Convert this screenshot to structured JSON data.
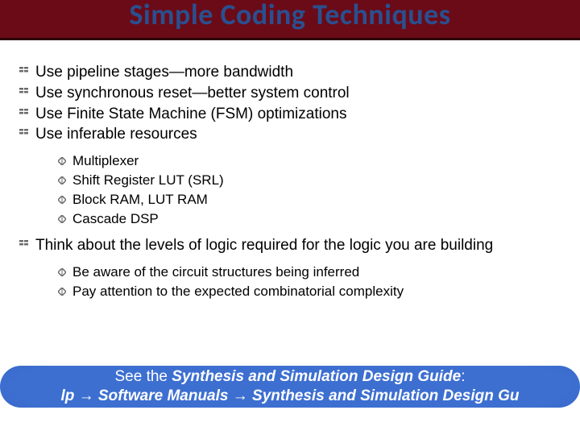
{
  "title": "Simple Coding Techniques",
  "bullets_top": [
    "Use pipeline stages—more bandwidth",
    "Use synchronous reset—better system control",
    "Use Finite State Machine (FSM) optimizations",
    "Use inferable resources"
  ],
  "sub_resources": [
    "Multiplexer",
    "Shift Register LUT (SRL)",
    "Block RAM, LUT RAM",
    "Cascade DSP"
  ],
  "bullets_mid": [
    "Think about the levels of logic required for the logic you are building"
  ],
  "sub_advice": [
    "Be aware of the circuit structures being inferred",
    "Pay attention to the expected combinatorial complexity"
  ],
  "footer": {
    "line1_a": "See the ",
    "line1_b": "Synthesis and Simulation Design Guide",
    "line1_c": ":",
    "line2_a": "lp ",
    "arrow": "→",
    "line2_b": " Software Manuals ",
    "line2_c": " Synthesis and Simulation Design Gu"
  }
}
